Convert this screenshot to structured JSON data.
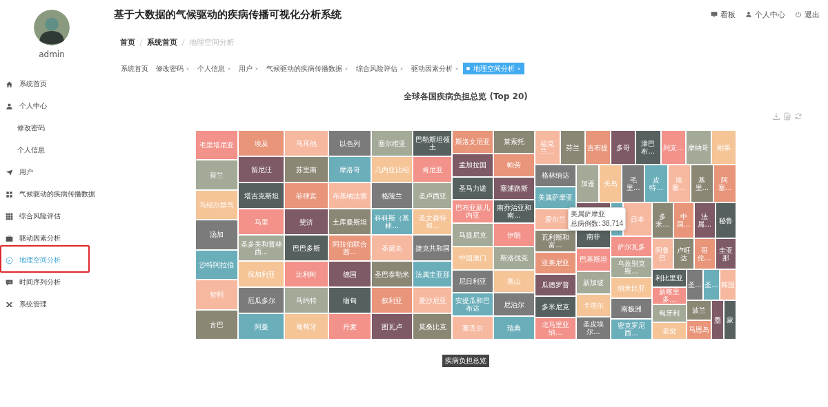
{
  "sidebar": {
    "user": {
      "name": "admin"
    },
    "items": [
      {
        "label": "系统首页",
        "selected": false
      },
      {
        "label": "个人中心",
        "selected": false,
        "children": [
          {
            "label": "修改密码",
            "selected": false
          },
          {
            "label": "个人信息",
            "selected": false
          }
        ]
      },
      {
        "label": "用户",
        "selected": false
      },
      {
        "label": "气候驱动的疾病传播数据",
        "selected": false
      },
      {
        "label": "综合风险评估",
        "selected": false
      },
      {
        "label": "驱动因素分析",
        "selected": false
      },
      {
        "label": "地理空间分析",
        "selected": true,
        "annotated": true
      },
      {
        "label": "时间序列分析",
        "selected": false
      },
      {
        "label": "系统管理",
        "selected": false
      }
    ]
  },
  "header": {
    "title": "基于大数据的气候驱动的疾病传播可视化分析系统",
    "links": [
      "看板",
      "个人中心",
      "退出"
    ]
  },
  "breadcrumb": [
    {
      "label": "首页",
      "current": false
    },
    {
      "label": "系统首页",
      "current": false
    },
    {
      "label": "地理空间分析",
      "current": true
    }
  ],
  "tabs": [
    {
      "label": "系统首页",
      "selected": false,
      "closable": false
    },
    {
      "label": "修改密码",
      "selected": false,
      "closable": true
    },
    {
      "label": "个人信息",
      "selected": false,
      "closable": true
    },
    {
      "label": "用户",
      "selected": false,
      "closable": true
    },
    {
      "label": "气候驱动的疾病传播数据",
      "selected": false,
      "closable": true
    },
    {
      "label": "综合风险评估",
      "selected": false,
      "closable": true
    },
    {
      "label": "驱动因素分析",
      "selected": false,
      "closable": true
    },
    {
      "label": "地理空间分析",
      "selected": true,
      "closable": true
    }
  ],
  "treemap": {
    "title": "全球各国疾病负担总览 (Top 20)",
    "footer": "疾病负担总览",
    "tooltip": {
      "title": "美属萨摩亚",
      "value": "总病例数: 38,714"
    },
    "tiles": [
      {
        "label": "毛里塔尼亚",
        "color": "#f2928a"
      },
      {
        "label": "荷兰",
        "color": "#a3aa98"
      },
      {
        "label": "马绍尔群岛",
        "color": "#f5c497"
      },
      {
        "label": "汤加",
        "color": "#7b7b7b"
      },
      {
        "label": "沙特阿拉伯",
        "color": "#6aaeba"
      },
      {
        "label": "智利",
        "color": "#f7b8a0"
      },
      {
        "label": "古巴",
        "color": "#8a8775"
      },
      {
        "label": "埃及",
        "color": "#e8957a"
      },
      {
        "label": "留尼汪",
        "color": "#7d5a65"
      },
      {
        "label": "塔吉克斯坦",
        "color": "#56605f"
      },
      {
        "label": "马里",
        "color": "#f2928a"
      },
      {
        "label": "圣多美和普林西...",
        "color": "#a3aa98"
      },
      {
        "label": "保加利亚",
        "color": "#f5c497"
      },
      {
        "label": "厄瓜多尔",
        "color": "#7b7b7b"
      },
      {
        "label": "阿曼",
        "color": "#6aaeba"
      },
      {
        "label": "马耳他",
        "color": "#f7b8a0"
      },
      {
        "label": "苏里南",
        "color": "#8a8775"
      },
      {
        "label": "菲律宾",
        "color": "#e8957a"
      },
      {
        "label": "斐济",
        "color": "#7d5a65"
      },
      {
        "label": "巴巴多斯",
        "color": "#56605f"
      },
      {
        "label": "比利时",
        "color": "#f2928a"
      },
      {
        "label": "马约特",
        "color": "#a3aa98"
      },
      {
        "label": "葡萄牙",
        "color": "#f5c497"
      },
      {
        "label": "以色列",
        "color": "#7b7b7b"
      },
      {
        "label": "摩洛哥",
        "color": "#6aaeba"
      },
      {
        "label": "布基纳法索",
        "color": "#f7b8a0"
      },
      {
        "label": "土库曼斯坦",
        "color": "#8a8775"
      },
      {
        "label": "阿拉伯联合酋...",
        "color": "#e8957a"
      },
      {
        "label": "德国",
        "color": "#7d5a65"
      },
      {
        "label": "缅甸",
        "color": "#56605f"
      },
      {
        "label": "丹麦",
        "color": "#f2928a"
      },
      {
        "label": "塞尔维亚",
        "color": "#a3aa98"
      },
      {
        "label": "几内亚比绍",
        "color": "#f5c497"
      },
      {
        "label": "格陵兰",
        "color": "#7b7b7b"
      },
      {
        "label": "科科斯（基林...",
        "color": "#6aaeba"
      },
      {
        "label": "圣诞岛",
        "color": "#f7b8a0"
      },
      {
        "label": "圣巴泰勒米",
        "color": "#8a8775"
      },
      {
        "label": "叙利亚",
        "color": "#e8957a"
      },
      {
        "label": "图瓦卢",
        "color": "#7d5a65"
      },
      {
        "label": "巴勒斯坦领土",
        "color": "#56605f"
      },
      {
        "label": "肯尼亚",
        "color": "#f2928a"
      },
      {
        "label": "圣卢西亚",
        "color": "#a3aa98"
      },
      {
        "label": "圣文森特和...",
        "color": "#f5c497"
      },
      {
        "label": "捷克共和国",
        "color": "#7b7b7b"
      },
      {
        "label": "法属圭亚那",
        "color": "#6aaeba"
      },
      {
        "label": "爱沙尼亚",
        "color": "#f7b8a0"
      },
      {
        "label": "莫桑比克",
        "color": "#8a8775"
      },
      {
        "label": "斯洛文尼亚",
        "color": "#e8957a"
      },
      {
        "label": "孟加拉国",
        "color": "#7d5a65"
      },
      {
        "label": "圣马力诺",
        "color": "#56605f"
      },
      {
        "label": "巴布亚新几内亚",
        "color": "#f2928a"
      },
      {
        "label": "马提尼克",
        "color": "#a3aa98"
      },
      {
        "label": "中国澳门",
        "color": "#f5c497"
      },
      {
        "label": "尼日利亚",
        "color": "#7b7b7b"
      },
      {
        "label": "安提瓜和巴布达",
        "color": "#6aaeba"
      },
      {
        "label": "塞舌尔",
        "color": "#f7b8a0"
      },
      {
        "label": "莱索托",
        "color": "#8a8775"
      },
      {
        "label": "帕劳",
        "color": "#e8957a"
      },
      {
        "label": "塞浦路斯",
        "color": "#7d5a65"
      },
      {
        "label": "南乔治亚和南...",
        "color": "#56605f"
      },
      {
        "label": "伊朗",
        "color": "#f2928a"
      },
      {
        "label": "斯洛伐克",
        "color": "#a3aa98"
      },
      {
        "label": "黑山",
        "color": "#f5c497"
      },
      {
        "label": "尼泊尔",
        "color": "#7b7b7b"
      },
      {
        "label": "瑞典",
        "color": "#6aaeba"
      },
      {
        "label": "福克兰...",
        "color": "#f7b8a0"
      },
      {
        "label": "芬兰",
        "color": "#8a8775"
      },
      {
        "label": "吉布提",
        "color": "#e8957a"
      },
      {
        "label": "多哥",
        "color": "#7d5a65"
      },
      {
        "label": "津巴布...",
        "color": "#56605f"
      },
      {
        "label": "列支...",
        "color": "#f2928a"
      },
      {
        "label": "摩纳哥",
        "color": "#a3aa98"
      },
      {
        "label": "刚果",
        "color": "#f5c497"
      },
      {
        "label": "格林纳达",
        "color": "#7b7b7b"
      },
      {
        "label": "美属萨摩亚",
        "color": "#6aaeba"
      },
      {
        "label": "爱尔兰",
        "color": "#f7b8a0"
      },
      {
        "label": "瓦利斯和富...",
        "color": "#8a8775"
      },
      {
        "label": "亚美尼亚",
        "color": "#e8957a"
      },
      {
        "label": "瓜德罗普",
        "color": "#7d5a65"
      },
      {
        "label": "多米尼克",
        "color": "#56605f"
      },
      {
        "label": "北马里亚纳...",
        "color": "#f2928a"
      },
      {
        "label": "加蓬",
        "color": "#a3aa98"
      },
      {
        "label": "关岛",
        "color": "#f5c497"
      },
      {
        "label": "毛里...",
        "color": "#7b7b7b"
      },
      {
        "label": "皮特...",
        "color": "#6aaeba"
      },
      {
        "label": "埃塞...",
        "color": "#f7b8a0"
      },
      {
        "label": "基里...",
        "color": "#8a8775"
      },
      {
        "label": "阿塞...",
        "color": "#e8957a"
      },
      {
        "color": "#7d5a65"
      },
      {
        "label": "南非",
        "color": "#56605f"
      },
      {
        "label": "巴基斯坦",
        "color": "#f2928a"
      },
      {
        "label": "新加坡",
        "color": "#a3aa98"
      },
      {
        "label": "卡塔尔",
        "color": "#f5c497"
      },
      {
        "label": "圣皮埃尔...",
        "color": "#7b7b7b"
      },
      {
        "color": "#6aaeba"
      },
      {
        "label": "日本",
        "color": "#f7b8a0"
      },
      {
        "label": "萨尔瓦多",
        "color": "#f2928a"
      },
      {
        "label": "乌兹别克斯...",
        "color": "#a3aa98"
      },
      {
        "label": "纳米比亚",
        "color": "#f5c497"
      },
      {
        "label": "南极洲",
        "color": "#7b7b7b"
      },
      {
        "label": "密克罗尼西...",
        "color": "#6aaeba"
      },
      {
        "label": "多米...",
        "color": "#8a8775"
      },
      {
        "label": "中国...",
        "color": "#e8957a"
      },
      {
        "label": "法属...",
        "color": "#7d5a65"
      },
      {
        "label": "秘鲁",
        "color": "#56605f"
      },
      {
        "label": "阿鲁巴",
        "color": "#f7b8a0"
      },
      {
        "label": "卢旺达",
        "color": "#8a8775"
      },
      {
        "label": "哥伦...",
        "color": "#e8957a"
      },
      {
        "label": "圭亚那",
        "color": "#7d5a65"
      },
      {
        "label": "利比里亚",
        "color": "#56605f"
      },
      {
        "label": "新喀里多...",
        "color": "#f2928a"
      },
      {
        "label": "匈牙利",
        "color": "#a3aa98"
      },
      {
        "label": "老挝",
        "color": "#f5c497"
      },
      {
        "label": "圣...",
        "color": "#7b7b7b"
      },
      {
        "label": "圣...",
        "color": "#6aaeba"
      },
      {
        "label": "韩国",
        "color": "#f7b8a0"
      },
      {
        "label": "波兰",
        "color": "#8a8775"
      },
      {
        "label": "马恩岛",
        "color": "#e8957a"
      },
      {
        "label": "墨",
        "color": "#7d5a65"
      },
      {
        "label": "蒙",
        "color": "#56605f"
      }
    ]
  }
}
